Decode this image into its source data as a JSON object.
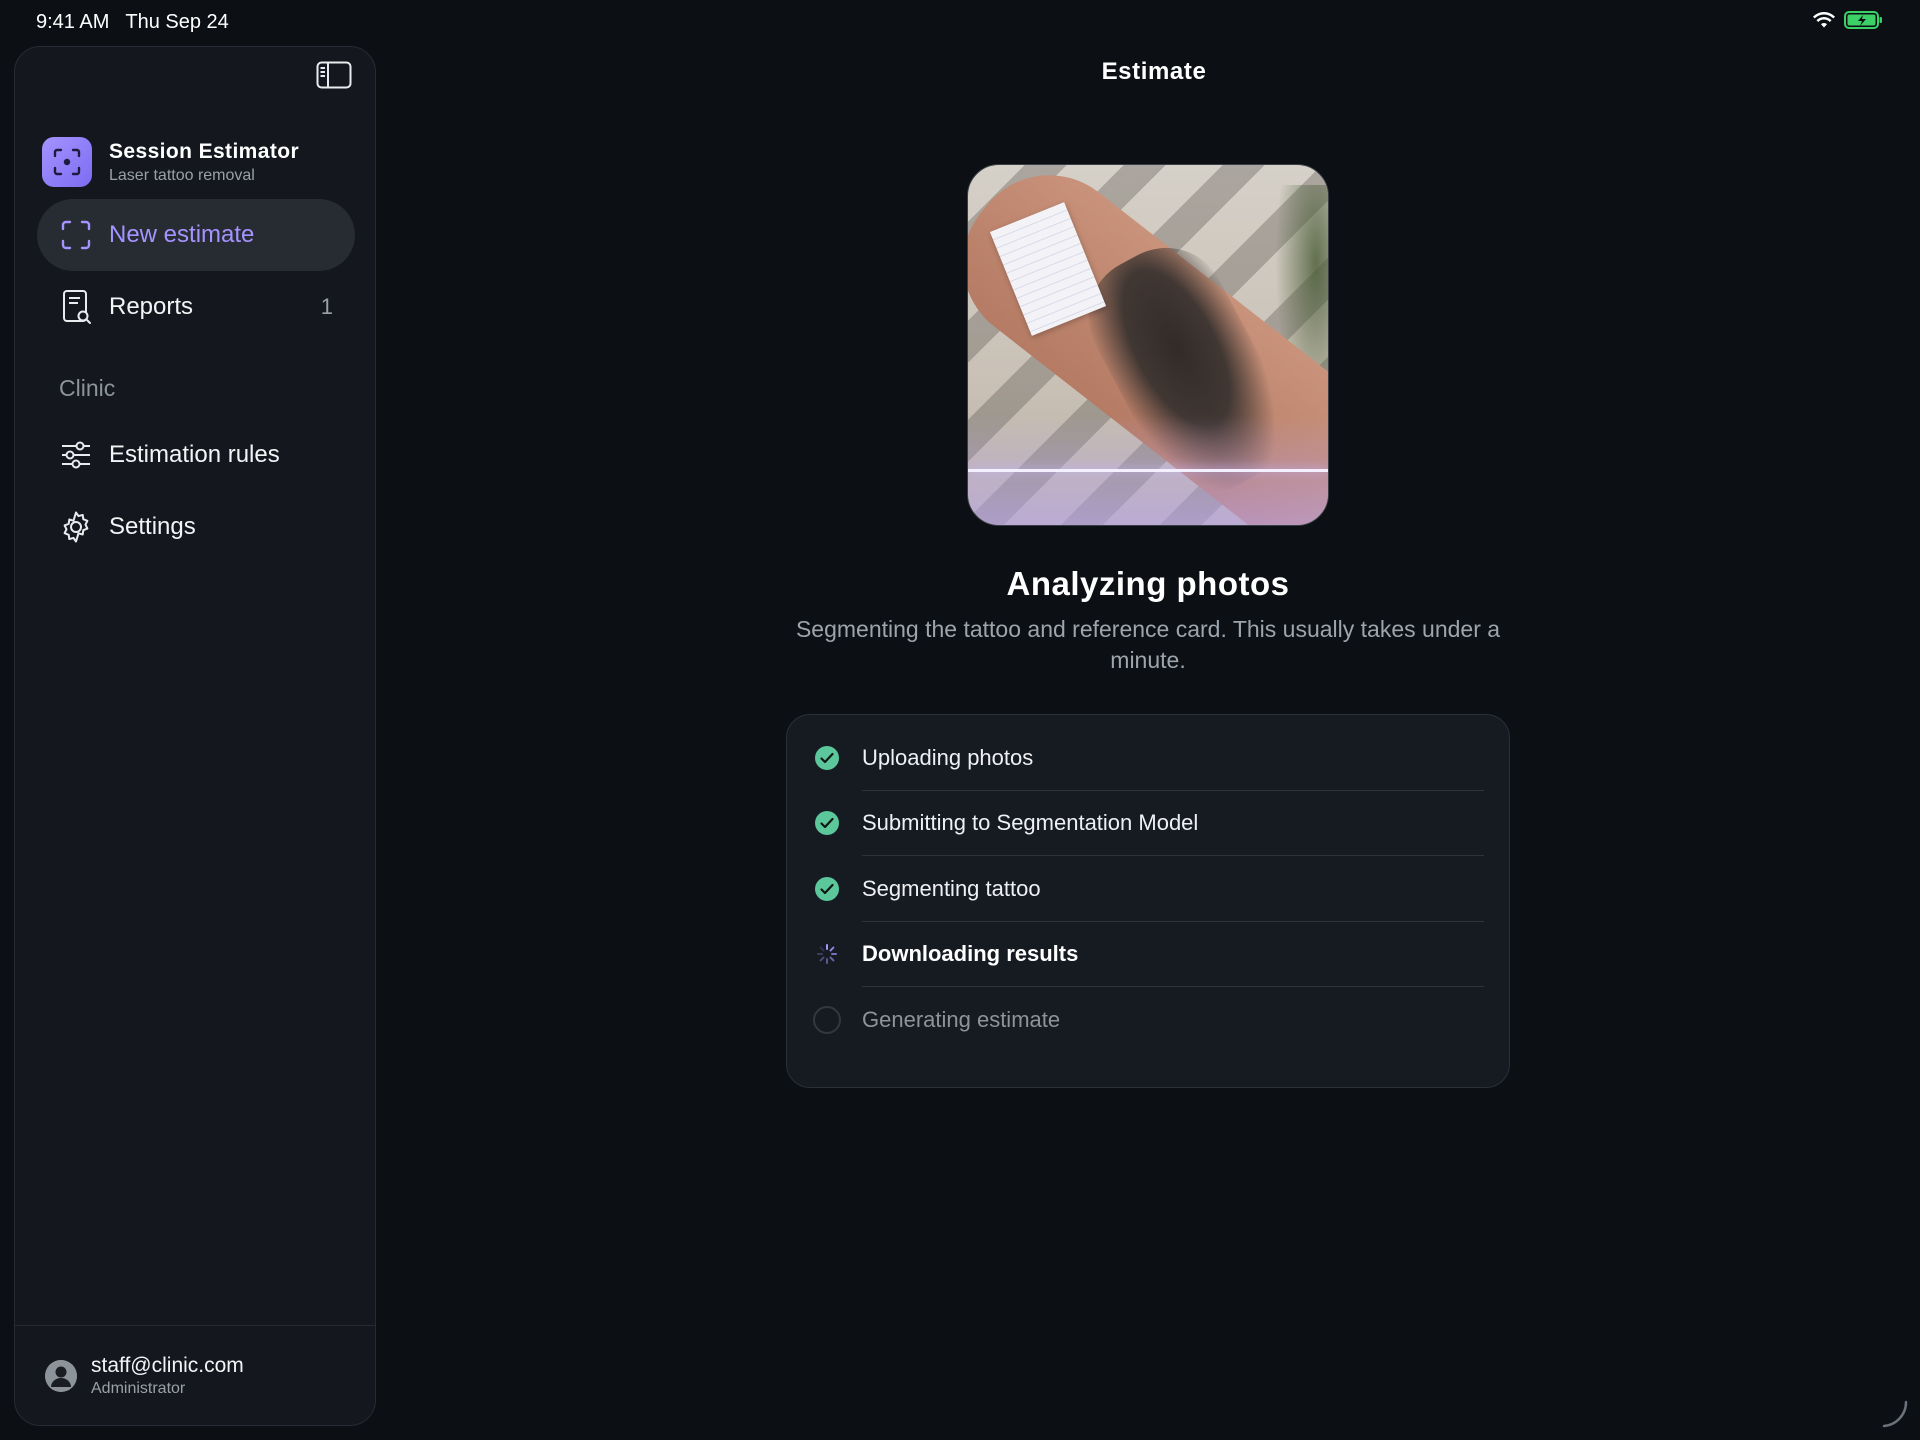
{
  "status_bar": {
    "time": "9:41 AM",
    "date": "Thu Sep 24"
  },
  "sidebar": {
    "brand": {
      "title": "Session Estimator",
      "subtitle": "Laser tattoo removal"
    },
    "items": [
      {
        "label": "New estimate",
        "icon": "scan-icon",
        "active": true
      },
      {
        "label": "Reports",
        "icon": "report-icon",
        "count": "1"
      }
    ],
    "section_label": "Clinic",
    "section_items": [
      {
        "label": "Estimation rules",
        "icon": "sliders-icon"
      },
      {
        "label": "Settings",
        "icon": "gear-icon"
      }
    ],
    "user": {
      "email": "staff@clinic.com",
      "role": "Administrator"
    }
  },
  "main": {
    "title": "Estimate",
    "heading": "Analyzing photos",
    "subtext": "Segmenting the tattoo and reference card. This usually takes under a minute.",
    "steps": [
      {
        "label": "Uploading photos",
        "status": "done"
      },
      {
        "label": "Submitting to Segmentation Model",
        "status": "done"
      },
      {
        "label": "Segmenting tattoo",
        "status": "done"
      },
      {
        "label": "Downloading results",
        "status": "in-progress"
      },
      {
        "label": "Generating estimate",
        "status": "pending"
      }
    ]
  },
  "colors": {
    "accent": "#a593ff",
    "success": "#5cc79a",
    "background": "#0c1015",
    "sidebar": "#14181e"
  }
}
